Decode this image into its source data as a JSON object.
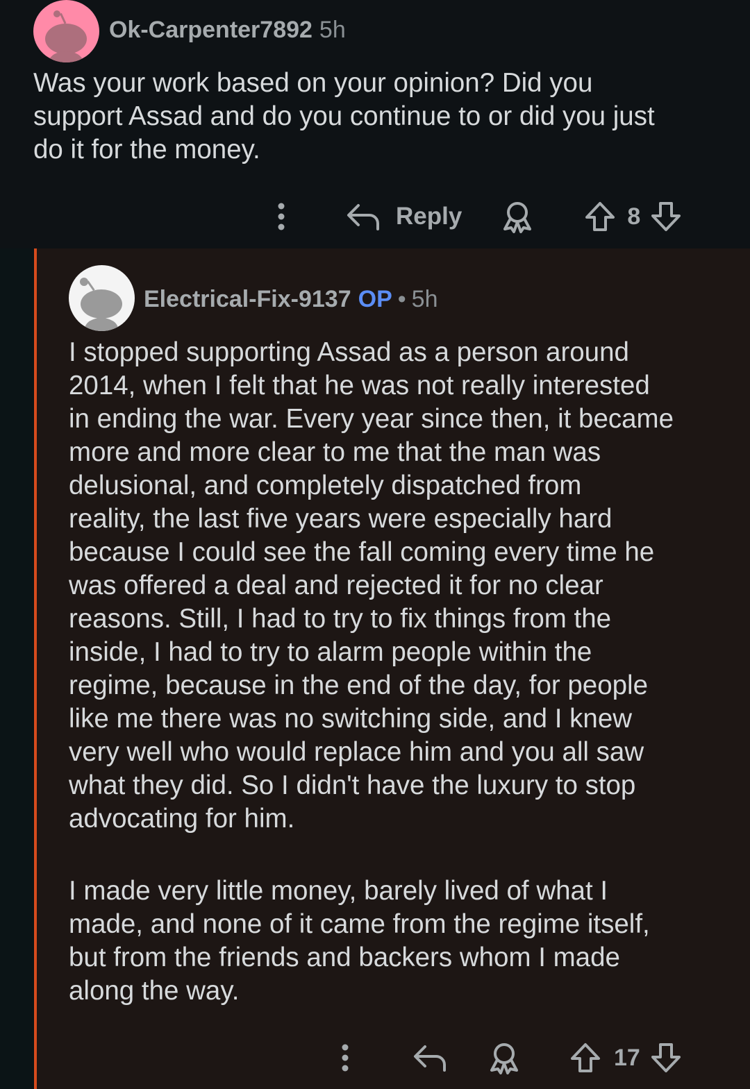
{
  "parent_comment": {
    "username": "Ok-Carpenter7892",
    "time": "5h",
    "body": "Was your work based on your opinion? Did you\nsupport Assad and do you continue to or did you just\ndo it for the money.",
    "reply_label": "Reply",
    "vote_count": "8"
  },
  "reply_comment": {
    "username": "Electrical-Fix-9137",
    "op_badge": "OP",
    "separator": "•",
    "time": "5h",
    "body_paragraph_1": "I stopped supporting Assad as a person around\n2014, when I felt that he was not really interested\nin ending the war. Every year since then, it became\nmore and more clear to me that the man was\ndelusional, and completely dispatched from\nreality, the last five years were especially hard\nbecause I could see the fall coming every time he\nwas offered a deal and rejected it for no clear\nreasons. Still, I had to try to fix things from the\ninside, I had to try to alarm people within the\nregime, because in the end of the day, for people\nlike me there was no switching side, and I knew\nvery well who would replace him and you all saw\nwhat they did. So I didn't have the luxury to stop\nadvocating for him.",
    "body_paragraph_2": "I made very little money, barely lived of what I\nmade, and none of it came from the regime itself,\nbut from the friends and backers whom I made\nalong the way.",
    "vote_count": "17"
  },
  "colors": {
    "background": "#0e1215",
    "reply_background": "#1d1614",
    "thread_line": "#d64b1d",
    "op_badge": "#5b8df5",
    "avatar_parent": "#ff8aa8",
    "avatar_reply": "#f4f4f4"
  },
  "icons": [
    "more-icon",
    "reply-arrow-icon",
    "award-icon",
    "upvote-icon",
    "downvote-icon",
    "snoo-avatar-icon"
  ]
}
